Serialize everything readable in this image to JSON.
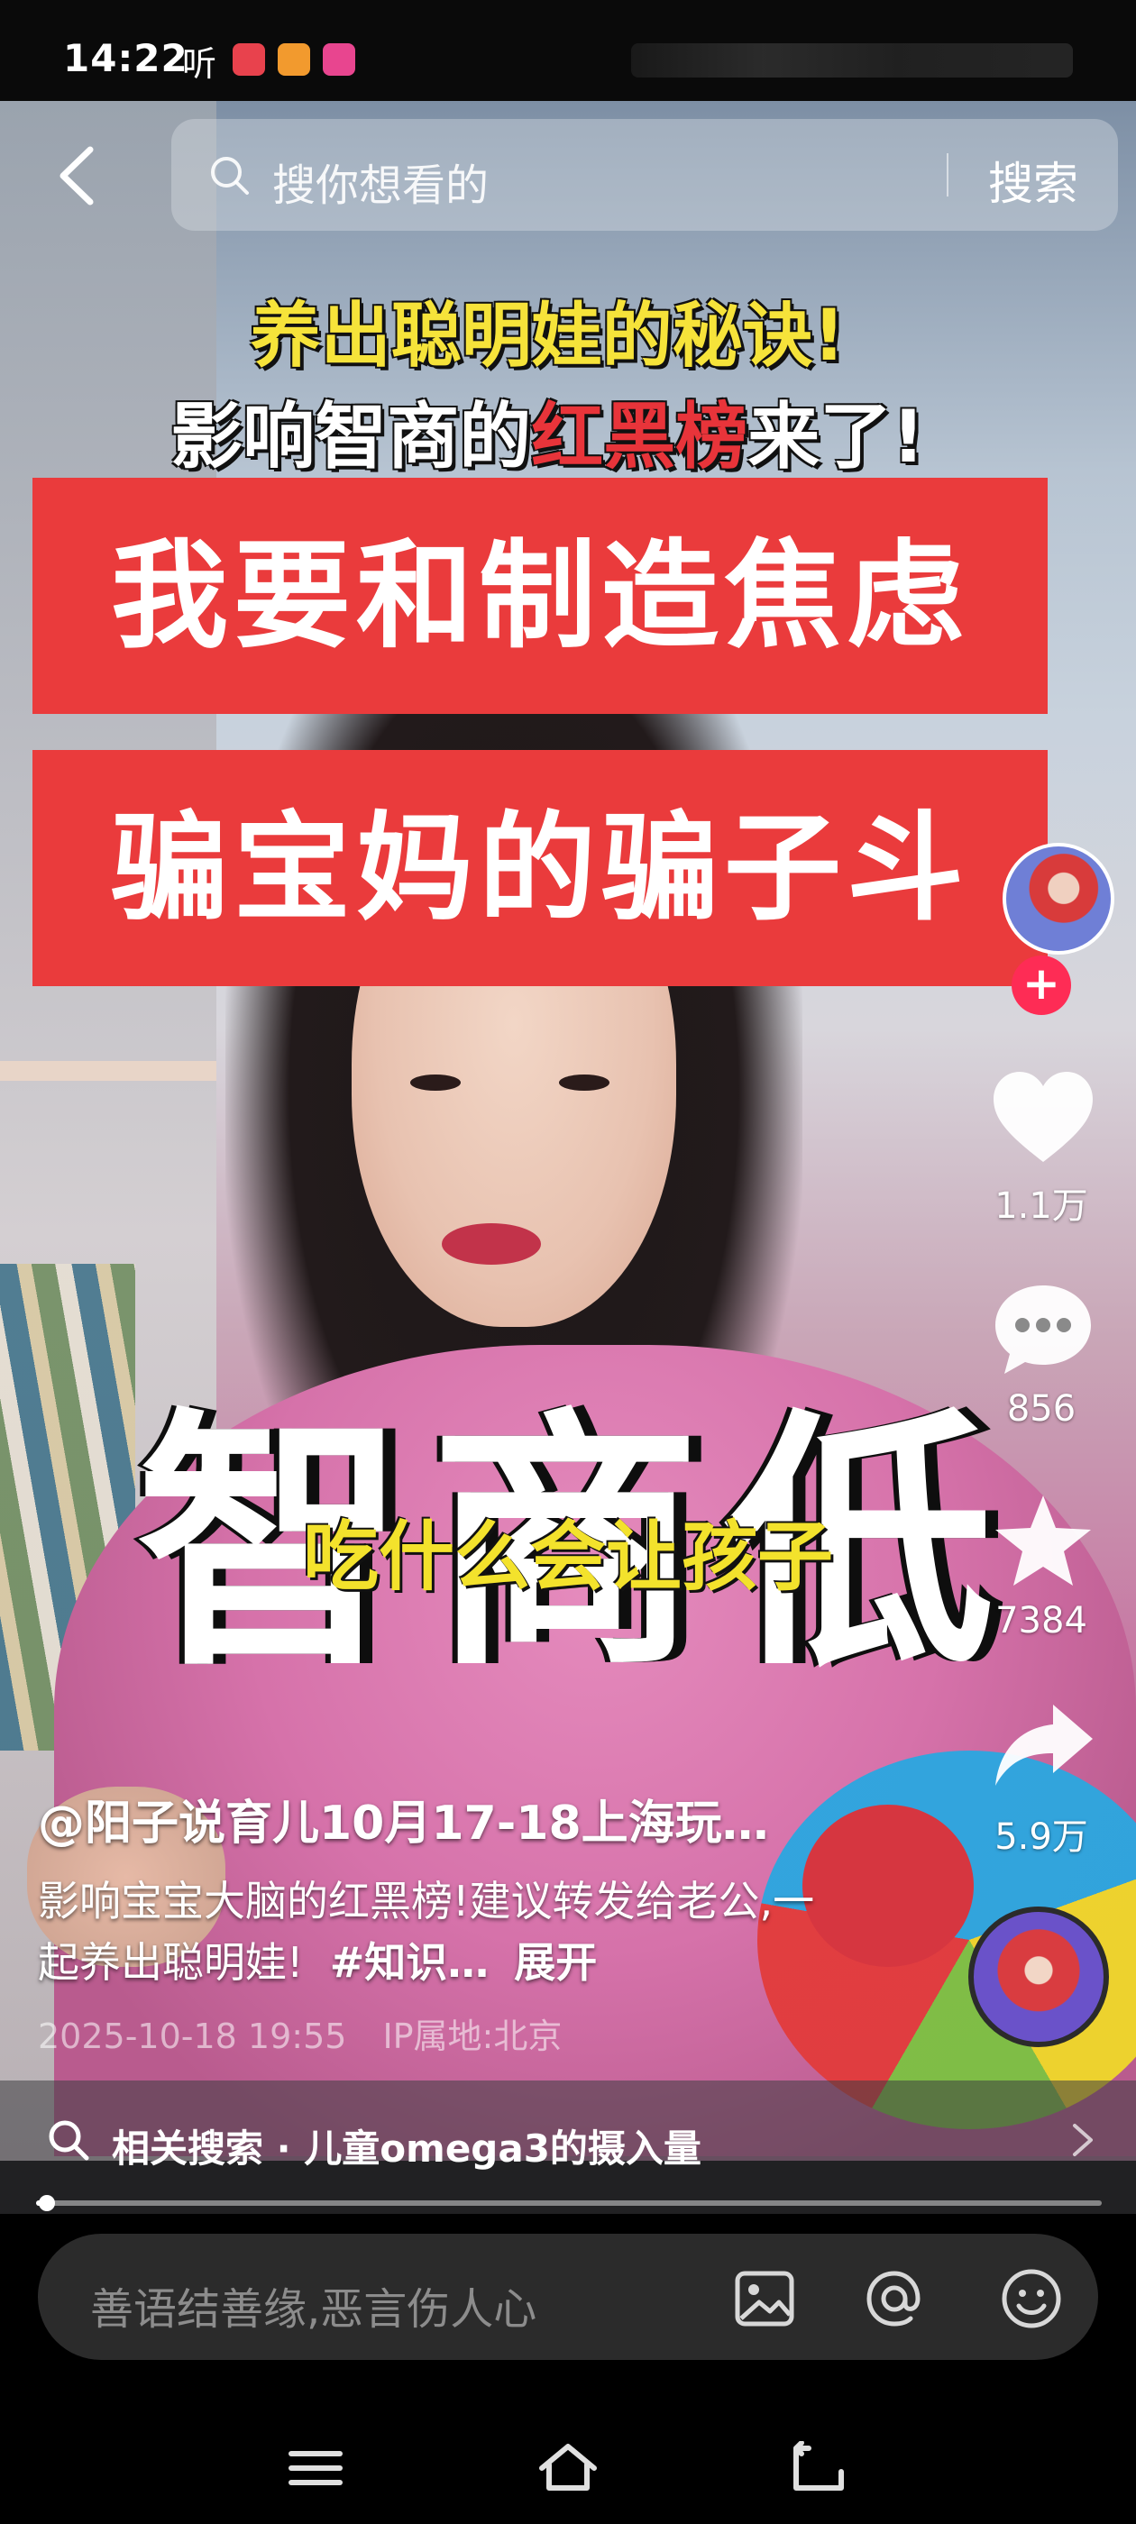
{
  "status_bar": {
    "time": "14:22",
    "listen_label": "听",
    "app_icon_colors": [
      "#e8424d",
      "#f29a2e",
      "#e8458f"
    ]
  },
  "search": {
    "placeholder": "搜你想看的",
    "button_label": "搜索"
  },
  "video_overlay": {
    "headline_yellow": "养出聪明娃的秘诀!",
    "headline_white_before": "影响智商的",
    "headline_white_highlight": "红黑榜",
    "headline_white_after": "来了!",
    "banner_1": "我要和制造焦虑",
    "banner_2": "骗宝妈的骗子斗",
    "big_text": "智商低",
    "small_yellow_text": "吃什么会让孩子"
  },
  "actions": {
    "follow_plus": "+",
    "likes": "1.1万",
    "comments": "856",
    "favorites": "7384",
    "shares": "5.9万"
  },
  "post": {
    "author": "@阳子说育儿10月17-18上海玩…",
    "description": "影响宝宝大脑的红黑榜!建议转发给老公,一起养出聪明娃!",
    "hashtag": "#知识…",
    "expand": "展开",
    "date": "2025-10-18 19:55",
    "ip_location": "IP属地:北京"
  },
  "related_search": {
    "text": "相关搜索 · 儿童omega3的摄入量"
  },
  "playback": {
    "progress_fraction": 0.01
  },
  "comment_bar": {
    "placeholder": "善语结善缘,恶言伤人心"
  },
  "colors": {
    "accent_red": "#fe2c55",
    "banner_red": "#ea3b3c",
    "headline_yellow": "#f6e33a"
  }
}
